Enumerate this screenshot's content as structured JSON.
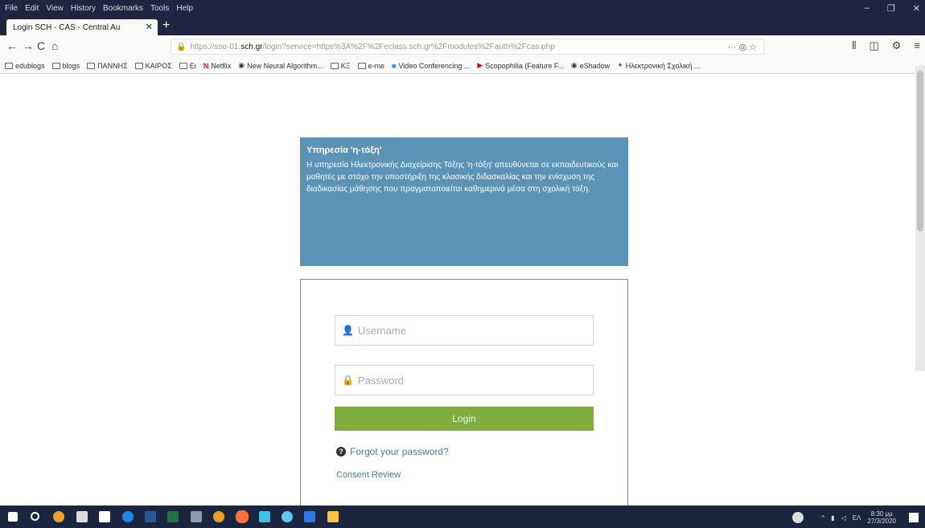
{
  "browser": {
    "menu": [
      "File",
      "Edit",
      "View",
      "History",
      "Bookmarks",
      "Tools",
      "Help"
    ],
    "window_controls": [
      "–",
      "❐",
      "✕"
    ],
    "tab_title": "Login SCH - CAS - Central Au",
    "tab_close": "✕",
    "new_tab": "+",
    "nav": {
      "back": "←",
      "forward": "→",
      "reload": "C",
      "home": "⌂"
    },
    "url": {
      "prefix": "https://sso-01.",
      "host": "sch.gr",
      "path": "/login?service=https%3A%2F%2Feclass.sch.gr%2Fmodules%2Fauth%2Fcas.php",
      "actions": "··· ◎ ☆"
    },
    "toolbar_right": [
      "⫴",
      "◫",
      "⚙",
      "≡"
    ],
    "bookmarks": [
      "edublogs",
      "blogs",
      "ΠΑΝΝΗΣ",
      "ΚΑΙΡΟΣ",
      "Ει",
      "Netflix",
      "New Neural Algorithm...",
      "ΚΞ",
      "e-me",
      "Video Conferencing ...",
      "Scopophilia (Feature F...",
      "eShadow",
      "Ηλεκτρονική Σχολική ..."
    ]
  },
  "page": {
    "info_title": "Υπηρεσία 'η-τάξη'",
    "info_text": "Η υπηρεσία Ηλεκτρονικής Διαχείρισης Τάξης 'η-τάξη' απευθύνεται σε εκπαιδευτικούς και μαθητές με στόχο την υποστήριξη της κλασικής διδασκαλίας και την ενίσχυση της διαδικασίας μάθησης που πραγματοποιείται καθημερινά μέσα στη σχολική τάξη.",
    "username_placeholder": "Username",
    "password_placeholder": "Password",
    "login_label": "Login",
    "forgot_label": "Forgot your password?",
    "consent_label": "Consent Review"
  },
  "taskbar": {
    "time": "8:30 μμ",
    "date": "27/3/2020",
    "lang": "ΕΛ"
  },
  "colors": {
    "info_bg": "#5b93b7",
    "login_button": "#7fae3c",
    "link": "#4a7aa0",
    "titlebar": "#1f2442"
  }
}
